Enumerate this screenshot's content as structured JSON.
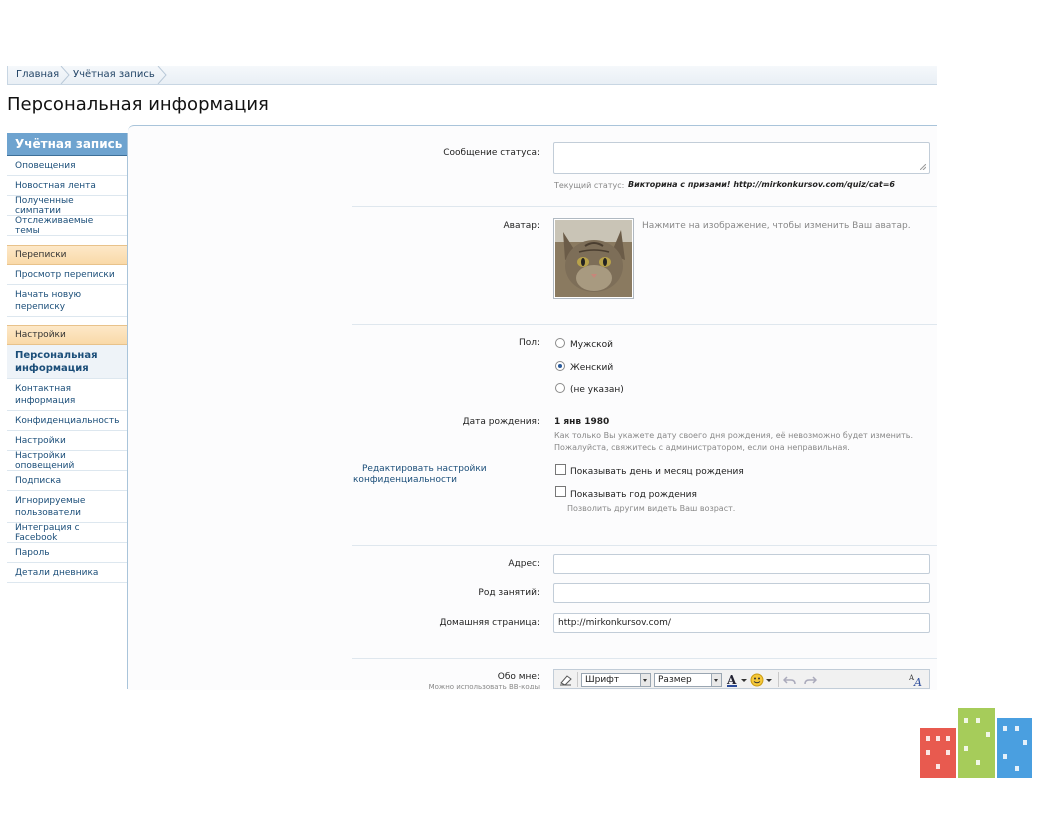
{
  "breadcrumb": {
    "home": "Главная",
    "account": "Учётная запись"
  },
  "page_title": "Персональная информация",
  "sidebar": {
    "header": "Учётная запись",
    "account_items": [
      "Оповещения",
      "Новостная лента",
      "Полученные симпатии",
      "Отслеживаемые темы"
    ],
    "group_messages": "Переписки",
    "message_items": [
      "Просмотр переписки",
      "Начать новую переписку"
    ],
    "group_settings": "Настройки",
    "active_item": "Персональная информация",
    "settings_items": [
      "Контактная информация",
      "Конфиденциальность",
      "Настройки",
      "Настройки оповещений",
      "Подписка",
      "Игнорируемые пользователи",
      "Интеграция с Facebook",
      "Пароль",
      "Детали дневника"
    ]
  },
  "form": {
    "status_label": "Сообщение статуса:",
    "current_status_label": "Текущий статус:",
    "current_status_value": "Викторина с призами! http://mirkonkursov.com/quiz/cat=6",
    "avatar_label": "Аватар:",
    "avatar_hint": "Нажмите на изображение, чтобы изменить Ваш аватар.",
    "gender_label": "Пол:",
    "gender_options": [
      "Мужской",
      "Женский",
      "(не указан)"
    ],
    "gender_selected": 1,
    "birthday_label": "Дата рождения:",
    "birthday_value": "1 янв 1980",
    "birthday_hint_1": "Как только Вы укажете дату своего дня рождения, её невозможно будет изменить.",
    "birthday_hint_2": "Пожалуйста, свяжитесь с администратором, если она неправильная.",
    "privacy_link_1": "Редактировать настройки",
    "privacy_link_2": "конфиденциальности",
    "show_day_month": "Показывать день и месяц рождения",
    "show_year": "Показывать год рождения",
    "show_year_hint": "Позволить другим видеть Ваш возраст.",
    "address_label": "Адрес:",
    "address_value": "",
    "occupation_label": "Род занятий:",
    "occupation_value": "",
    "homepage_label": "Домашняя страница:",
    "homepage_value": "http://mirkonkursov.com/",
    "about_label": "Обо мне:",
    "about_hint": "Можно использовать BB-коды"
  },
  "editor": {
    "font_label": "Шрифт",
    "size_label": "Размер"
  },
  "colors": {
    "sidebar_header": "#6ea3cf",
    "group_bg": "#f9d9a8",
    "link": "#1b4e79"
  }
}
